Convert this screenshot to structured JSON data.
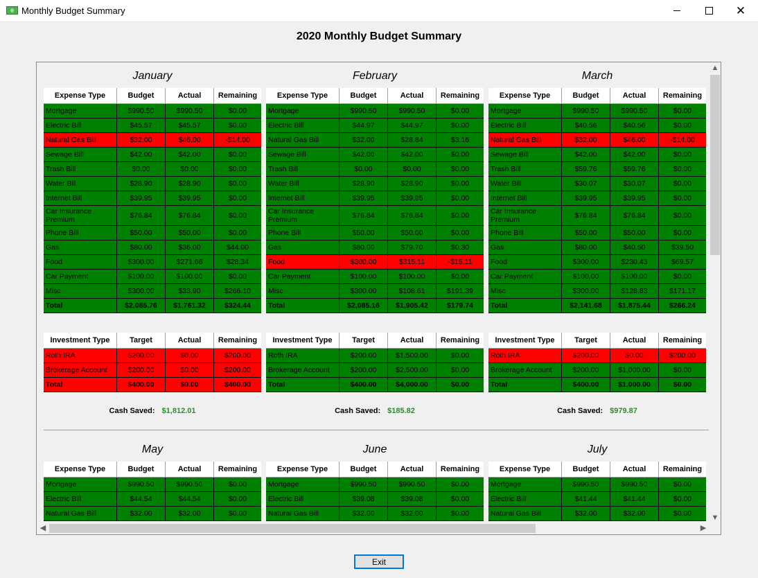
{
  "window": {
    "title": "Monthly Budget Summary",
    "min_glyph": "—",
    "max_glyph": "☐",
    "close_glyph": "✕"
  },
  "main_title": "2020 Monthly Budget Summary",
  "expense_headers": [
    "Expense Type",
    "Budget",
    "Actual",
    "Remaining"
  ],
  "investment_headers": [
    "Investment Type",
    "Target",
    "Actual",
    "Remaining"
  ],
  "cash_saved_label": "Cash Saved:",
  "exit_label": "Exit",
  "colors": {
    "under_budget": "#008000",
    "over_budget": "#ff0000",
    "cash_saved": "#2e8b2e"
  },
  "months_row1": [
    {
      "name": "January",
      "expenses": [
        [
          "Mortgage",
          "$990.50",
          "$990.50",
          "$0.00",
          "ok"
        ],
        [
          "Electric Bill",
          "$45.57",
          "$45.57",
          "$0.00",
          "ok"
        ],
        [
          "Natural Gas Bill",
          "$32.00",
          "$46.00",
          "-$14.00",
          "over"
        ],
        [
          "Sewage Bill",
          "$42.00",
          "$42.00",
          "$0.00",
          "ok"
        ],
        [
          "Trash Bill",
          "$0.00",
          "$0.00",
          "$0.00",
          "ok"
        ],
        [
          "Water Bill",
          "$28.90",
          "$28.90",
          "$0.00",
          "ok"
        ],
        [
          "Internet Bill",
          "$39.95",
          "$39.95",
          "$0.00",
          "ok"
        ],
        [
          "Car Insurance Premium",
          "$76.84",
          "$76.84",
          "$0.00",
          "ok"
        ],
        [
          "Phone Bill",
          "$50.00",
          "$50.00",
          "$0.00",
          "ok"
        ],
        [
          "Gas",
          "$80.00",
          "$36.00",
          "$44.00",
          "ok"
        ],
        [
          "Food",
          "$300.00",
          "$271.66",
          "$28.34",
          "ok"
        ],
        [
          "Car Payment",
          "$100.00",
          "$100.00",
          "$0.00",
          "ok"
        ],
        [
          "Misc",
          "$300.00",
          "$33.90",
          "$266.10",
          "ok"
        ],
        [
          "Total",
          "$2,085.76",
          "$1,761.32",
          "$324.44",
          "ok"
        ]
      ],
      "investments": [
        [
          "Roth IRA",
          "$200.00",
          "$0.00",
          "$200.00",
          "over"
        ],
        [
          "Brokerage Account",
          "$200.00",
          "$0.00",
          "$200.00",
          "over"
        ],
        [
          "Total",
          "$400.00",
          "$0.00",
          "$400.00",
          "over"
        ]
      ],
      "cash_saved": "$1,812.01"
    },
    {
      "name": "February",
      "expenses": [
        [
          "Mortgage",
          "$990.50",
          "$990.50",
          "$0.00",
          "ok"
        ],
        [
          "Electric Bill",
          "$44.97",
          "$44.97",
          "$0.00",
          "ok"
        ],
        [
          "Natural Gas Bill",
          "$32.00",
          "$28.84",
          "$3.16",
          "ok"
        ],
        [
          "Sewage Bill",
          "$42.00",
          "$42.00",
          "$0.00",
          "ok"
        ],
        [
          "Trash Bill",
          "$0.00",
          "$0.00",
          "$0.00",
          "ok"
        ],
        [
          "Water Bill",
          "$28.90",
          "$28.90",
          "$0.00",
          "ok"
        ],
        [
          "Internet Bill",
          "$39.95",
          "$39.95",
          "$0.00",
          "ok"
        ],
        [
          "Car Insurance Premium",
          "$76.84",
          "$76.84",
          "$0.00",
          "ok"
        ],
        [
          "Phone Bill",
          "$50.00",
          "$50.00",
          "$0.00",
          "ok"
        ],
        [
          "Gas",
          "$80.00",
          "$79.70",
          "$0.30",
          "ok"
        ],
        [
          "Food",
          "$300.00",
          "$315.11",
          "-$15.11",
          "over"
        ],
        [
          "Car Payment",
          "$100.00",
          "$100.00",
          "$0.00",
          "ok"
        ],
        [
          "Misc",
          "$300.00",
          "$108.61",
          "$191.39",
          "ok"
        ],
        [
          "Total",
          "$2,085.16",
          "$1,905.42",
          "$179.74",
          "ok"
        ]
      ],
      "investments": [
        [
          "Roth IRA",
          "$200.00",
          "$1,500.00",
          "$0.00",
          "ok"
        ],
        [
          "Brokerage Account",
          "$200.00",
          "$2,500.00",
          "$0.00",
          "ok"
        ],
        [
          "Total",
          "$400.00",
          "$4,000.00",
          "$0.00",
          "ok"
        ]
      ],
      "cash_saved": "$185.82"
    },
    {
      "name": "March",
      "expenses": [
        [
          "Mortgage",
          "$990.50",
          "$990.50",
          "$0.00",
          "ok"
        ],
        [
          "Electric Bill",
          "$40.56",
          "$40.56",
          "$0.00",
          "ok"
        ],
        [
          "Natural Gas Bill",
          "$32.00",
          "$46.00",
          "-$14.00",
          "over"
        ],
        [
          "Sewage Bill",
          "$42.00",
          "$42.00",
          "$0.00",
          "ok"
        ],
        [
          "Trash Bill",
          "$59.76",
          "$59.76",
          "$0.00",
          "ok"
        ],
        [
          "Water Bill",
          "$30.07",
          "$30.07",
          "$0.00",
          "ok"
        ],
        [
          "Internet Bill",
          "$39.95",
          "$39.95",
          "$0.00",
          "ok"
        ],
        [
          "Car Insurance Premium",
          "$76.84",
          "$76.84",
          "$0.00",
          "ok"
        ],
        [
          "Phone Bill",
          "$50.00",
          "$50.00",
          "$0.00",
          "ok"
        ],
        [
          "Gas",
          "$80.00",
          "$40.50",
          "$39.50",
          "ok"
        ],
        [
          "Food",
          "$300.00",
          "$230.43",
          "$69.57",
          "ok"
        ],
        [
          "Car Payment",
          "$100.00",
          "$100.00",
          "$0.00",
          "ok"
        ],
        [
          "Misc",
          "$300.00",
          "$128.83",
          "$171.17",
          "ok"
        ],
        [
          "Total",
          "$2,141.68",
          "$1,875.44",
          "$266.24",
          "ok"
        ]
      ],
      "investments": [
        [
          "Roth IRA",
          "$200.00",
          "$0.00",
          "$200.00",
          "over"
        ],
        [
          "Brokerage Account",
          "$200.00",
          "$1,000.00",
          "$0.00",
          "ok"
        ],
        [
          "Total",
          "$400.00",
          "$1,000.00",
          "$0.00",
          "ok"
        ]
      ],
      "cash_saved": "$979.87"
    }
  ],
  "months_row2": [
    {
      "name": "May",
      "expenses": [
        [
          "Mortgage",
          "$990.50",
          "$990.50",
          "$0.00",
          "ok"
        ],
        [
          "Electric Bill",
          "$44.54",
          "$44.54",
          "$0.00",
          "ok"
        ],
        [
          "Natural Gas Bill",
          "$32.00",
          "$32.00",
          "$0.00",
          "ok"
        ]
      ]
    },
    {
      "name": "June",
      "expenses": [
        [
          "Mortgage",
          "$990.50",
          "$990.50",
          "$0.00",
          "ok"
        ],
        [
          "Electric Bill",
          "$39.08",
          "$39.08",
          "$0.00",
          "ok"
        ],
        [
          "Natural Gas Bill",
          "$32.00",
          "$32.00",
          "$0.00",
          "ok"
        ]
      ]
    },
    {
      "name": "July",
      "expenses": [
        [
          "Mortgage",
          "$990.50",
          "$990.50",
          "$0.00",
          "ok"
        ],
        [
          "Electric Bill",
          "$41.44",
          "$41.44",
          "$0.00",
          "ok"
        ],
        [
          "Natural Gas Bill",
          "$32.00",
          "$32.00",
          "$0.00",
          "ok"
        ]
      ]
    }
  ]
}
